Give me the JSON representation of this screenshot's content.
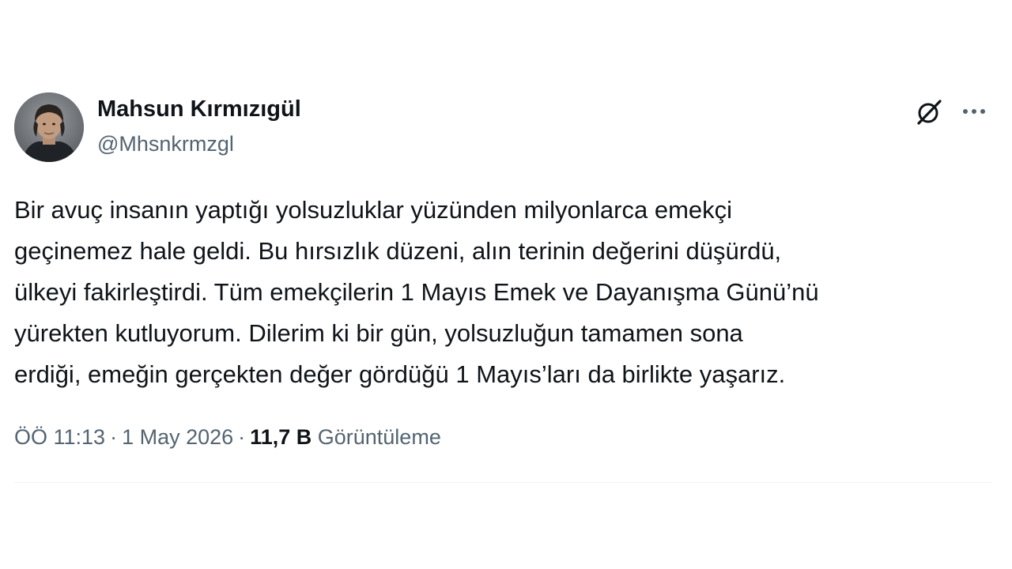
{
  "author": {
    "name": "Mahsun Kırmızıgül",
    "handle": "@Mhsnkrmzgl"
  },
  "icons": {
    "grok": "grok-icon",
    "more": "more-icon"
  },
  "tweet": {
    "lines": [
      "Bir avuç insanın yaptığı yolsuzluklar yüzünden milyonlarca emekçi",
      "geçinemez hale geldi. Bu hırsızlık düzeni, alın terinin değerini düşürdü,",
      "ülkeyi fakirleştirdi. Tüm emekçilerin 1 Mayıs Emek ve Dayanışma Günü’nü",
      "yürekten kutluyorum. Dilerim ki bir gün, yolsuzluğun tamamen sona",
      "erdiği, emeğin gerçekten değer gördüğü 1 Mayıs’ları da birlikte yaşarız."
    ]
  },
  "meta": {
    "time": "ÖÖ 11:13",
    "separator": "·",
    "date": "1 May 2026",
    "views_count": "11,7 B",
    "views_label": "Görüntüleme"
  },
  "colors": {
    "text_primary": "#0f1419",
    "text_secondary": "#536471",
    "divider": "#eff3f4"
  }
}
